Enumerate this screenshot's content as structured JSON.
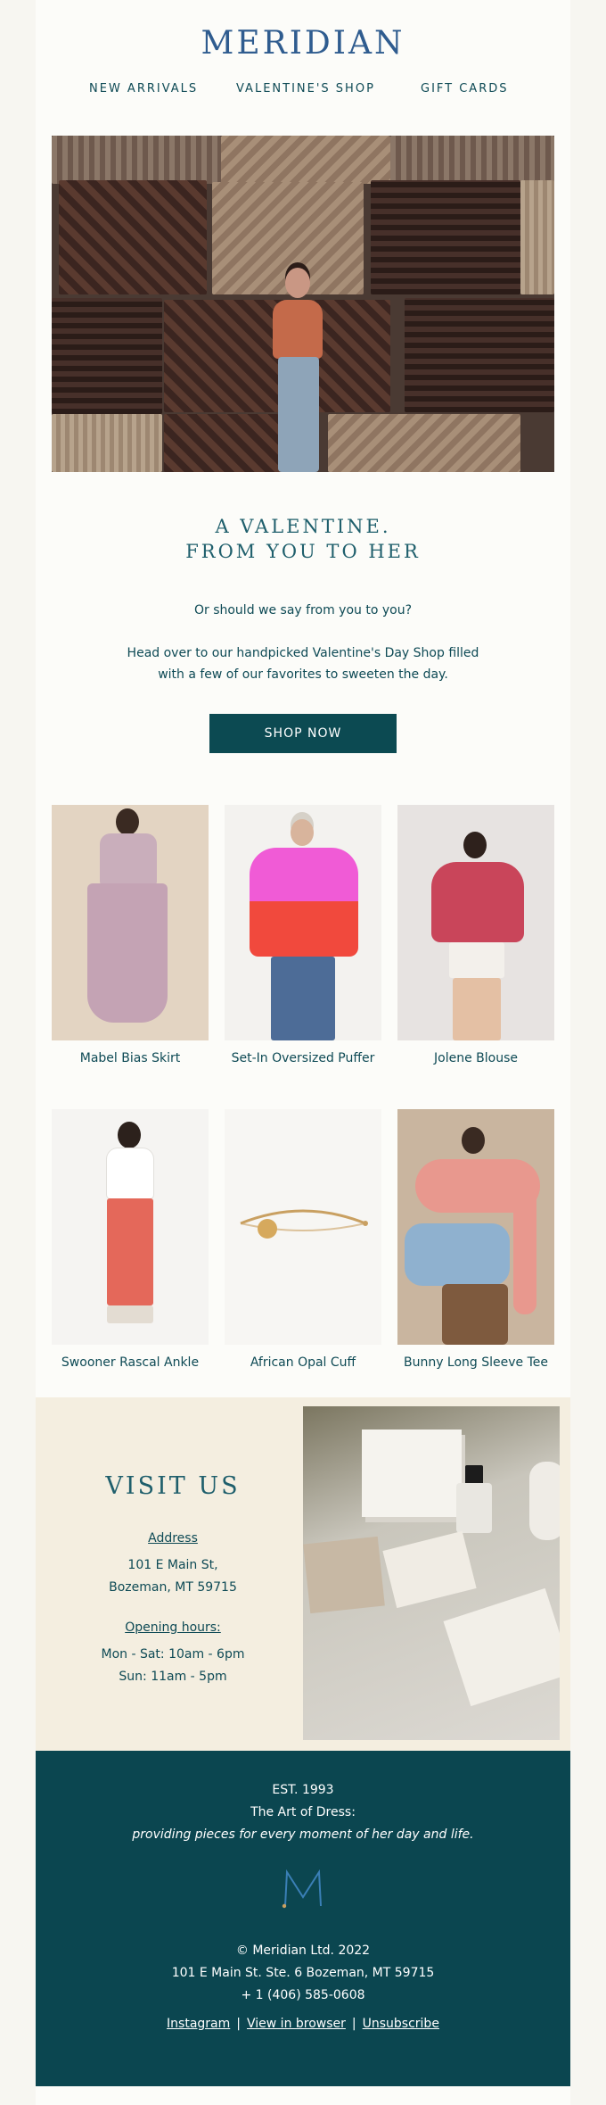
{
  "brand": {
    "logo_text": "MERIDIAN"
  },
  "nav": {
    "items": [
      "NEW ARRIVALS",
      "VALENTINE'S SHOP",
      "GIFT CARDS"
    ]
  },
  "hero": {
    "headline_line1": "A VALENTINE.",
    "headline_line2": "FROM YOU TO HER",
    "subline": "Or should we say from you to you?",
    "body_line1": "Head over to our handpicked Valentine's Day Shop filled",
    "body_line2": "with a few of our favorites to sweeten the day.",
    "cta_label": "SHOP NOW"
  },
  "products": [
    {
      "name": "Mabel Bias Skirt"
    },
    {
      "name": "Set-In Oversized Puffer"
    },
    {
      "name": "Jolene Blouse"
    },
    {
      "name": "Swooner Rascal Ankle"
    },
    {
      "name": "African Opal Cuff"
    },
    {
      "name": "Bunny Long Sleeve Tee"
    }
  ],
  "visit": {
    "title": "VISIT US",
    "address_label": "Address",
    "address_line1": "101 E Main St,",
    "address_line2": "Bozeman, MT 59715",
    "hours_label": "Opening hours:",
    "hours_line1": "Mon - Sat: 10am - 6pm",
    "hours_line2": "Sun: 11am - 5pm"
  },
  "footer": {
    "est": "EST. 1993",
    "tagline": "The Art of Dress:",
    "tagline_italic": "providing pieces for every moment of her day and life.",
    "copyright": "© Meridian Ltd. 2022",
    "address": "101 E Main St. Ste. 6 Bozeman, MT 59715",
    "phone": "+ 1 (406) 585-0608",
    "links": {
      "instagram": "Instagram",
      "view_in_browser": "View in browser",
      "unsubscribe": "Unsubscribe"
    },
    "separator": "|"
  },
  "colors": {
    "accent": "#0c4a52",
    "logo": "#2f5c8f",
    "visit_bg": "#f4eee0",
    "page_bg": "#fcfcf9"
  }
}
